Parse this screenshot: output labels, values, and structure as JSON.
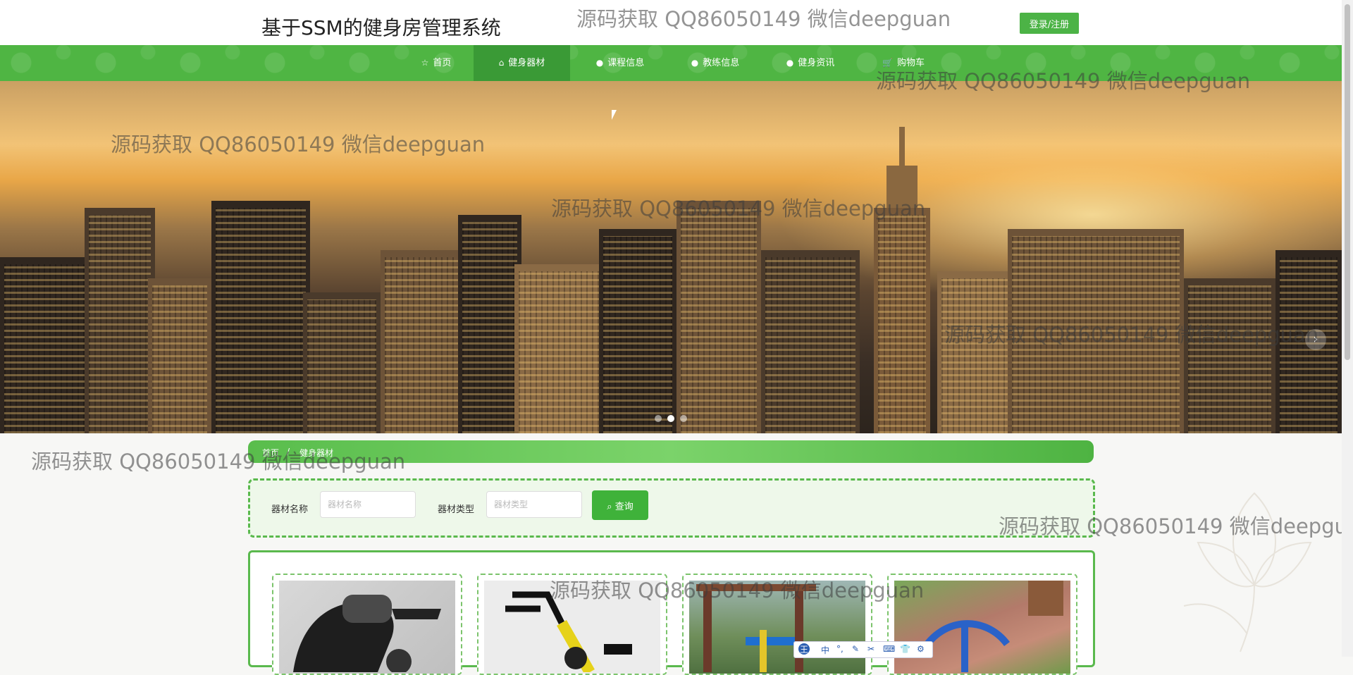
{
  "header": {
    "title": "基于SSM的健身房管理系统",
    "login_label": "登录/注册"
  },
  "nav": {
    "items": [
      {
        "label": "首页",
        "icon": "star-icon",
        "active": false
      },
      {
        "label": "健身器材",
        "icon": "home-icon",
        "active": true
      },
      {
        "label": "课程信息",
        "icon": "info-icon",
        "active": false
      },
      {
        "label": "教练信息",
        "icon": "info-icon",
        "active": false
      },
      {
        "label": "健身资讯",
        "icon": "info-icon",
        "active": false
      },
      {
        "label": "购物车",
        "icon": "cart-icon",
        "active": false
      }
    ]
  },
  "carousel": {
    "next_icon": "chevron-right-icon",
    "slide_count": 3,
    "active_slide": 2
  },
  "breadcrumb": {
    "home": "首页",
    "separator": "/",
    "current": "健身器材"
  },
  "search": {
    "name_label": "器材名称",
    "name_placeholder": "器材名称",
    "type_label": "器材类型",
    "type_placeholder": "器材类型",
    "button_label": "查询",
    "button_icon": "search-icon"
  },
  "products": [
    {
      "image": "exercise-bike-rider-image"
    },
    {
      "image": "spin-bike-image"
    },
    {
      "image": "outdoor-fitness-equipment-image"
    },
    {
      "image": "outdoor-fitness-equipment-path-image"
    }
  ],
  "watermark": {
    "text": "源码获取 QQ86050149 微信deepguan",
    "text_cut": "源码获取 QQ86050149 微信deepgua"
  },
  "ime_toolbar": {
    "items": [
      "王",
      "中",
      "°,",
      "✎",
      "✂",
      "⌨",
      "👕",
      "⚙"
    ]
  },
  "colors": {
    "primary_green": "#4fb543",
    "active_nav": "#3a9a36",
    "button_green": "#3fb23a"
  }
}
